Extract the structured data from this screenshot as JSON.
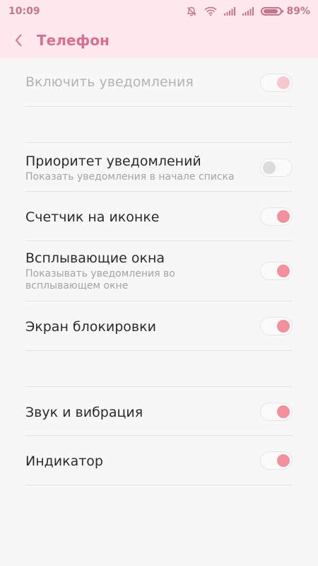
{
  "status": {
    "time": "10:09",
    "battery_percent": "89%",
    "battery_level": 0.89
  },
  "header": {
    "title": "Телефон"
  },
  "settings": {
    "enable_notifications": {
      "title": "Включить уведомления",
      "on": true,
      "disabled": true
    },
    "priority": {
      "title": "Приоритет уведомлений",
      "subtitle": "Показать уведомления в начале списка",
      "on": false
    },
    "badge": {
      "title": "Счетчик на иконке",
      "on": true
    },
    "popup": {
      "title": "Всплывающие окна",
      "subtitle": "Показывать уведомления во всплывающем окне",
      "on": true
    },
    "lockscreen": {
      "title": "Экран блокировки",
      "on": true
    },
    "sound": {
      "title": "Звук и вибрация",
      "on": true
    },
    "indicator": {
      "title": "Индикатор",
      "on": true
    }
  },
  "colors": {
    "accent": "#d86f8e",
    "toggle_on": "#f3909e",
    "header_bg": "#fde9ee"
  }
}
